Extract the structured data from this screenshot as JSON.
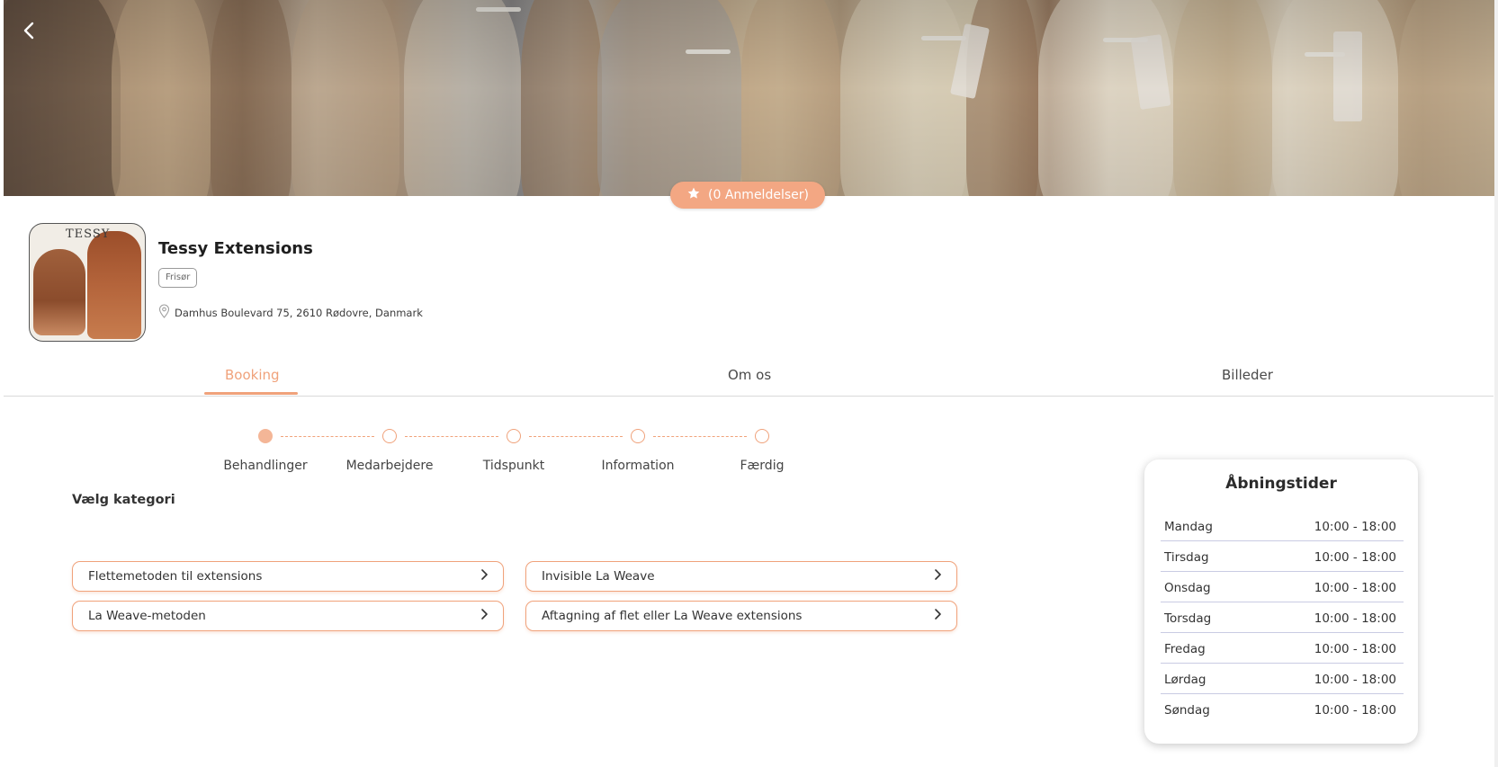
{
  "hero": {
    "rating_label": "(0 Anmeldelser)"
  },
  "profile": {
    "logo_text": "TESSY",
    "name": "Tessy Extensions",
    "category": "Frisør",
    "address": "Damhus Boulevard 75, 2610 Rødovre, Danmark"
  },
  "tabs": [
    {
      "label": "Booking",
      "active": true
    },
    {
      "label": "Om os",
      "active": false
    },
    {
      "label": "Billeder",
      "active": false
    }
  ],
  "steps": [
    {
      "label": "Behandlinger",
      "done": true
    },
    {
      "label": "Medarbejdere",
      "done": false
    },
    {
      "label": "Tidspunkt",
      "done": false
    },
    {
      "label": "Information",
      "done": false
    },
    {
      "label": "Færdig",
      "done": false
    }
  ],
  "booking": {
    "section_title": "Vælg kategori",
    "categories": [
      "Flettemetoden til extensions",
      "Invisible La Weave",
      "La Weave-metoden",
      "Aftagning af flet eller La Weave extensions"
    ]
  },
  "hours": {
    "title": "Åbningstider",
    "rows": [
      {
        "day": "Mandag",
        "time": "10:00 - 18:00"
      },
      {
        "day": "Tirsdag",
        "time": "10:00 - 18:00"
      },
      {
        "day": "Onsdag",
        "time": "10:00 - 18:00"
      },
      {
        "day": "Torsdag",
        "time": "10:00 - 18:00"
      },
      {
        "day": "Fredag",
        "time": "10:00 - 18:00"
      },
      {
        "day": "Lørdag",
        "time": "10:00 - 18:00"
      },
      {
        "day": "Søndag",
        "time": "10:00 - 18:00"
      }
    ]
  },
  "colors": {
    "accent": "#f0a27b",
    "accent_fill": "#f3a783",
    "divider": "#c9cbe3"
  },
  "icons": {
    "back": "chevron-left-icon",
    "rating": "star-icon",
    "address": "map-pin-icon",
    "category_arrow": "chevron-right-icon"
  }
}
